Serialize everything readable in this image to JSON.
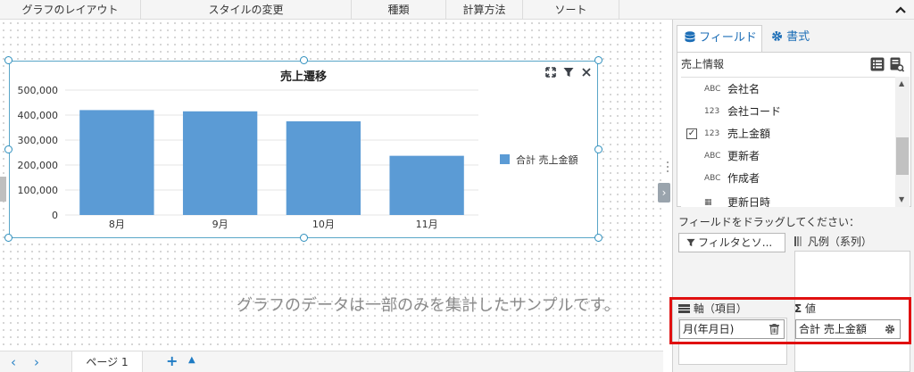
{
  "ribbon": {
    "tabs": [
      "グラフのレイアウト",
      "スタイルの変更",
      "種類",
      "計算方法",
      "ソート"
    ]
  },
  "canvas": {
    "notice": "グラフのデータは一部のみを集計したサンプルです。"
  },
  "bottombar": {
    "page_label": "ページ 1"
  },
  "panel": {
    "tab_fields": "フィールド",
    "tab_format": "書式",
    "section": "売上情報",
    "fields": [
      {
        "type": "ABC",
        "name": "会社名",
        "checked": false
      },
      {
        "type": "123",
        "name": "会社コード",
        "checked": false
      },
      {
        "type": "123",
        "name": "売上金額",
        "checked": true
      },
      {
        "type": "ABC",
        "name": "更新者",
        "checked": false
      },
      {
        "type": "ABC",
        "name": "作成者",
        "checked": false
      },
      {
        "type": "date",
        "name": "更新日時",
        "checked": false
      }
    ],
    "drag_hint": "フィールドをドラッグしてください：",
    "filter_button": "フィルタとソ...",
    "legend_well": "凡例（系列）",
    "axis_well": "軸（項目）",
    "value_well": "値",
    "axis_field": "月(年月日)",
    "value_field": "合計 売上金額"
  },
  "colors": {
    "bar": "#5b9bd5",
    "accent": "#1e6fb7",
    "highlight": "#e01010"
  },
  "chart_data": {
    "type": "bar",
    "title": "売上遷移",
    "categories": [
      "8月",
      "9月",
      "10月",
      "11月"
    ],
    "series": [
      {
        "name": "合計 売上金額",
        "values": [
          420000,
          415000,
          375000,
          237000
        ]
      }
    ],
    "yticks": [
      "0",
      "100,000",
      "200,000",
      "300,000",
      "400,000",
      "500,000"
    ],
    "ylim": [
      0,
      500000
    ],
    "grid": true,
    "legend": "right"
  }
}
